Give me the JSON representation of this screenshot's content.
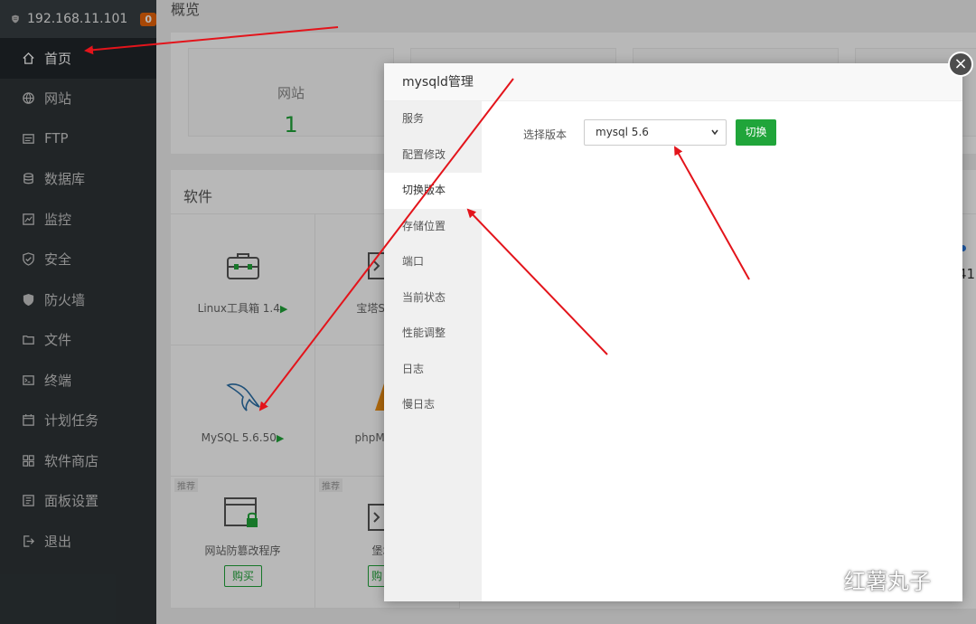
{
  "sidebar": {
    "host": "192.168.11.101",
    "badge": "0",
    "items": [
      {
        "label": "首页",
        "icon": "home-icon",
        "active": true
      },
      {
        "label": "网站",
        "icon": "globe-icon"
      },
      {
        "label": "FTP",
        "icon": "ftp-icon"
      },
      {
        "label": "数据库",
        "icon": "database-icon"
      },
      {
        "label": "监控",
        "icon": "monitor-icon"
      },
      {
        "label": "安全",
        "icon": "shield-check-icon"
      },
      {
        "label": "防火墙",
        "icon": "firewall-icon"
      },
      {
        "label": "文件",
        "icon": "folder-icon"
      },
      {
        "label": "终端",
        "icon": "terminal-icon"
      },
      {
        "label": "计划任务",
        "icon": "calendar-icon"
      },
      {
        "label": "软件商店",
        "icon": "apps-icon"
      },
      {
        "label": "面板设置",
        "icon": "settings-panel-icon"
      },
      {
        "label": "退出",
        "icon": "logout-icon"
      }
    ]
  },
  "main": {
    "overview_title": "概览",
    "stats": [
      {
        "label": "网站",
        "value": "1"
      }
    ],
    "software_title": "软件",
    "software": [
      {
        "name": "Linux工具箱 1.4",
        "icon": "toolbox-icon"
      },
      {
        "name": "宝塔SSH",
        "icon": "ssh-terminal-icon"
      },
      {
        "name": "MySQL 5.6.50",
        "icon": "mysql-dolphin-icon"
      },
      {
        "name": "phpMyAd",
        "icon": "phpmyadmin-icon"
      },
      {
        "name": "网站防篡改程序",
        "icon": "tamper-lock-icon",
        "tag": "推荐",
        "button": "购买"
      },
      {
        "name": "堡塔",
        "icon": "fortress-icon",
        "tag": "推荐",
        "button": "购"
      }
    ],
    "partial_text": {
      "right_num": "41"
    }
  },
  "modal": {
    "title": "mysqld管理",
    "close": "×",
    "nav": [
      "服务",
      "配置修改",
      "切换版本",
      "存储位置",
      "端口",
      "当前状态",
      "性能调整",
      "日志",
      "慢日志"
    ],
    "active_nav": "切换版本",
    "version_label": "选择版本",
    "version_selected": "mysql 5.6",
    "switch_button": "切换"
  },
  "watermark": {
    "text": "红薯丸子"
  },
  "colors": {
    "accent": "#20a53a",
    "sidebar_bg": "#2e3437",
    "badge": "#e8650b",
    "annotation": "#e3141b"
  }
}
